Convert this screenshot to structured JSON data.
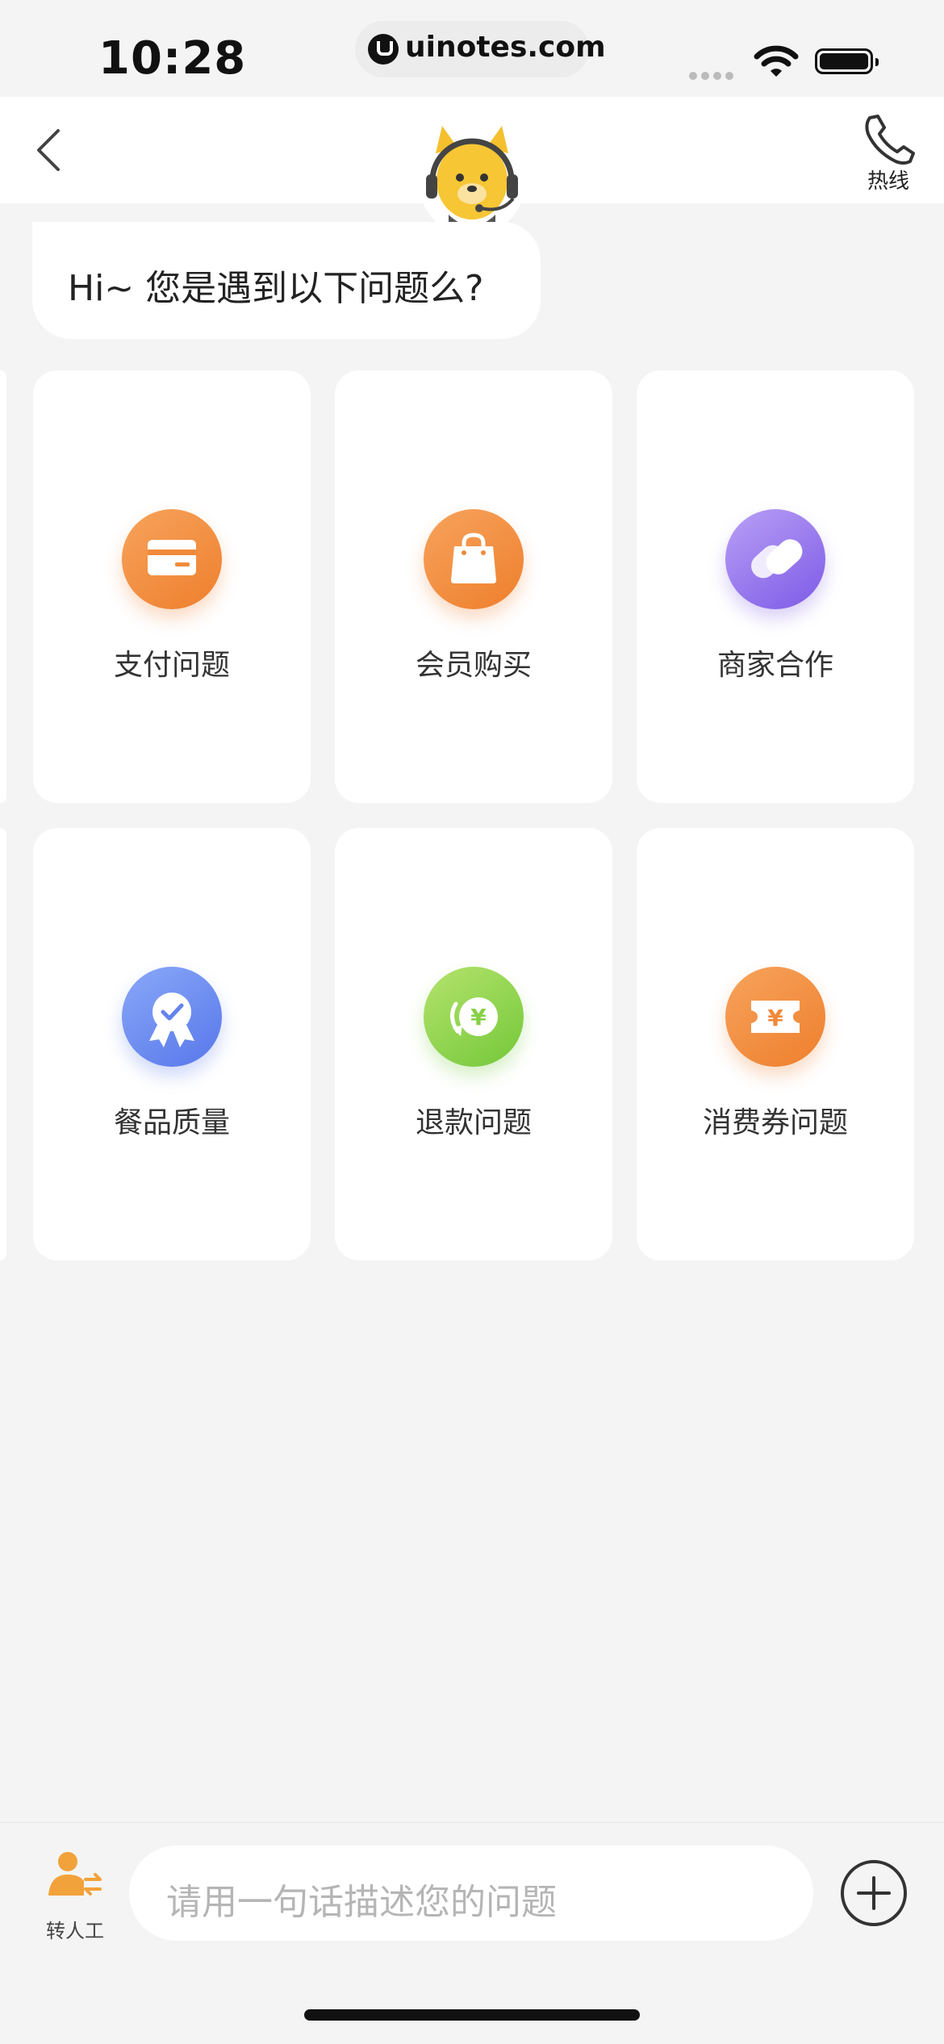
{
  "status_bar": {
    "time": "10:28",
    "url": "uinotes.com"
  },
  "header": {
    "hotline_label": "热线"
  },
  "greeting": "Hi~ 您是遇到以下问题么?",
  "cards": [
    {
      "label": "支付问题",
      "icon": "card-payment-icon",
      "color": "#f08a3a"
    },
    {
      "label": "会员购买",
      "icon": "shopping-bag-icon",
      "color": "#f08a3a"
    },
    {
      "label": "商家合作",
      "icon": "heart-icon",
      "color": "#8b6aea"
    },
    {
      "label": "餐品质量",
      "icon": "quality-badge-icon",
      "color": "#6483ef"
    },
    {
      "label": "退款问题",
      "icon": "refund-icon",
      "color": "#86d047"
    },
    {
      "label": "消费券问题",
      "icon": "coupon-icon",
      "color": "#f08a3a"
    }
  ],
  "bottom_bar": {
    "human_label": "转人工",
    "input_placeholder": "请用一句话描述您的问题"
  }
}
